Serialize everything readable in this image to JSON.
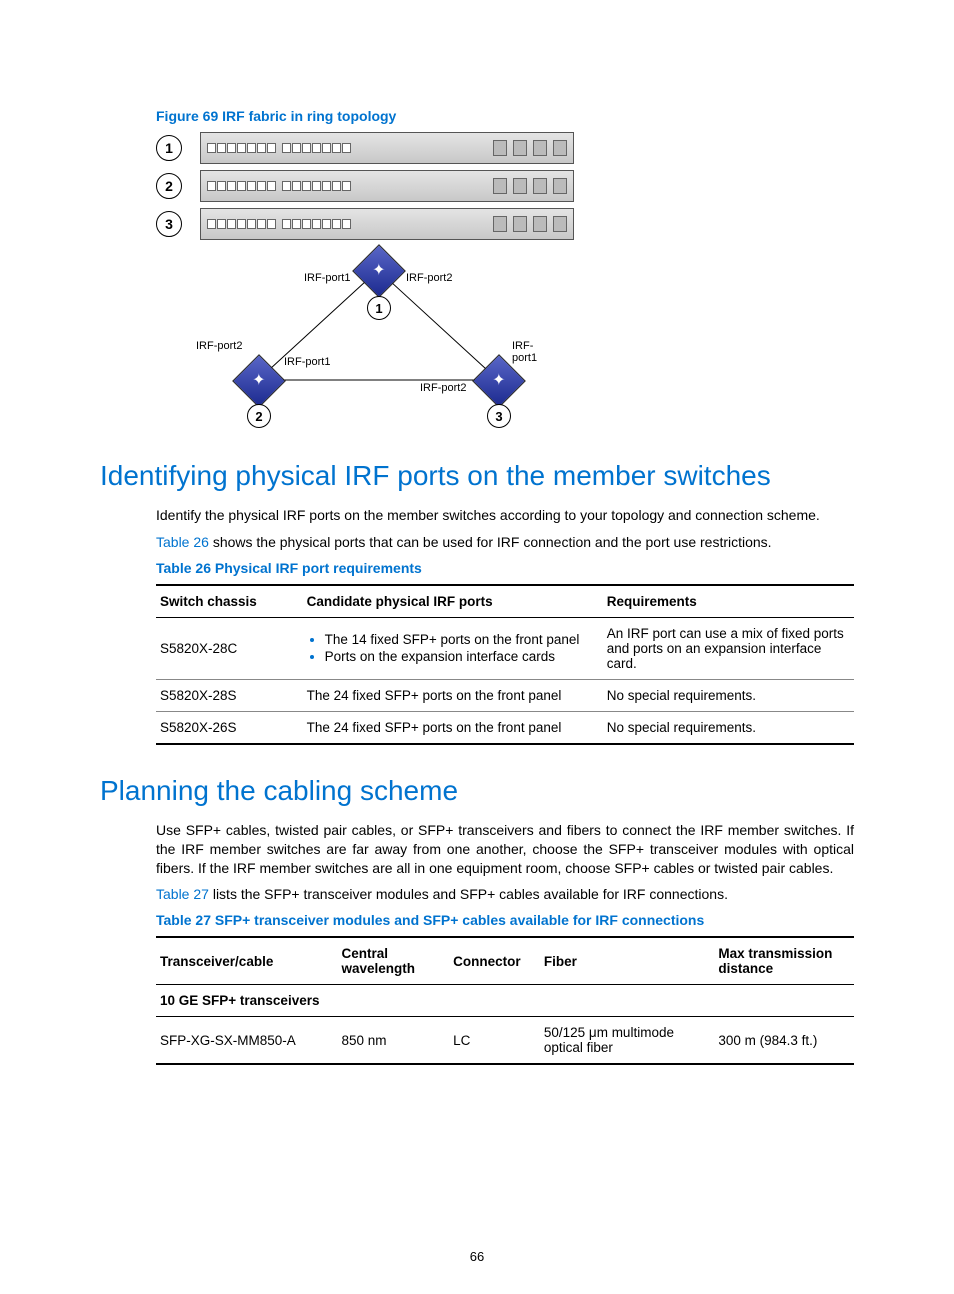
{
  "figure69": {
    "caption": "Figure 69 IRF fabric in ring topology",
    "rack_labels": [
      "1",
      "2",
      "3"
    ],
    "topology": {
      "node1": "1",
      "node2": "2",
      "node3": "3",
      "labels": {
        "top_left": "IRF-port1",
        "top_right": "IRF-port2",
        "left_upper": "IRF-port2",
        "left_lower": "IRF-port1",
        "right_upper": "IRF-port1",
        "right_lower": "IRF-port2"
      }
    }
  },
  "section1": {
    "heading": "Identifying physical IRF ports on the member switches",
    "p1": "Identify the physical IRF ports on the member switches according to your topology and connection scheme.",
    "p2_pre": "Table 26",
    "p2_post": " shows the physical ports that can be used for IRF connection and the port use restrictions."
  },
  "table26": {
    "caption": "Table 26 Physical IRF port requirements",
    "headers": [
      "Switch chassis",
      "Candidate physical IRF ports",
      "Requirements"
    ],
    "rows": [
      {
        "chassis": "S5820X-28C",
        "ports": [
          "The 14 fixed SFP+ ports on the front panel",
          "Ports on the expansion interface cards"
        ],
        "req": "An IRF port can use a mix of fixed ports and ports on an expansion interface card."
      },
      {
        "chassis": "S5820X-28S",
        "ports_text": "The 24 fixed SFP+ ports on the front panel",
        "req": "No special requirements."
      },
      {
        "chassis": "S5820X-26S",
        "ports_text": "The 24 fixed SFP+ ports on the front panel",
        "req": "No special requirements."
      }
    ]
  },
  "section2": {
    "heading": "Planning the cabling scheme",
    "p1": "Use SFP+ cables, twisted pair cables, or SFP+ transceivers and fibers to connect the IRF member switches. If the IRF member switches are far away from one another, choose the SFP+ transceiver modules with optical fibers. If the IRF member switches are all in one equipment room, choose SFP+ cables or twisted pair cables.",
    "p2_pre": "Table 27",
    "p2_post": " lists the SFP+ transceiver modules and SFP+ cables available for IRF connections."
  },
  "table27": {
    "caption": "Table 27 SFP+ transceiver modules and SFP+ cables available for IRF connections",
    "headers": [
      "Transceiver/cable",
      "Central wavelength",
      "Connector",
      "Fiber",
      "Max transmission distance"
    ],
    "section_row": "10 GE SFP+ transceivers",
    "rows": [
      {
        "name": "SFP-XG-SX-MM850-A",
        "wavelength": "850 nm",
        "connector": "LC",
        "fiber": "50/125 μm multimode optical fiber",
        "distance": "300 m (984.3 ft.)"
      }
    ]
  },
  "page_number": "66"
}
